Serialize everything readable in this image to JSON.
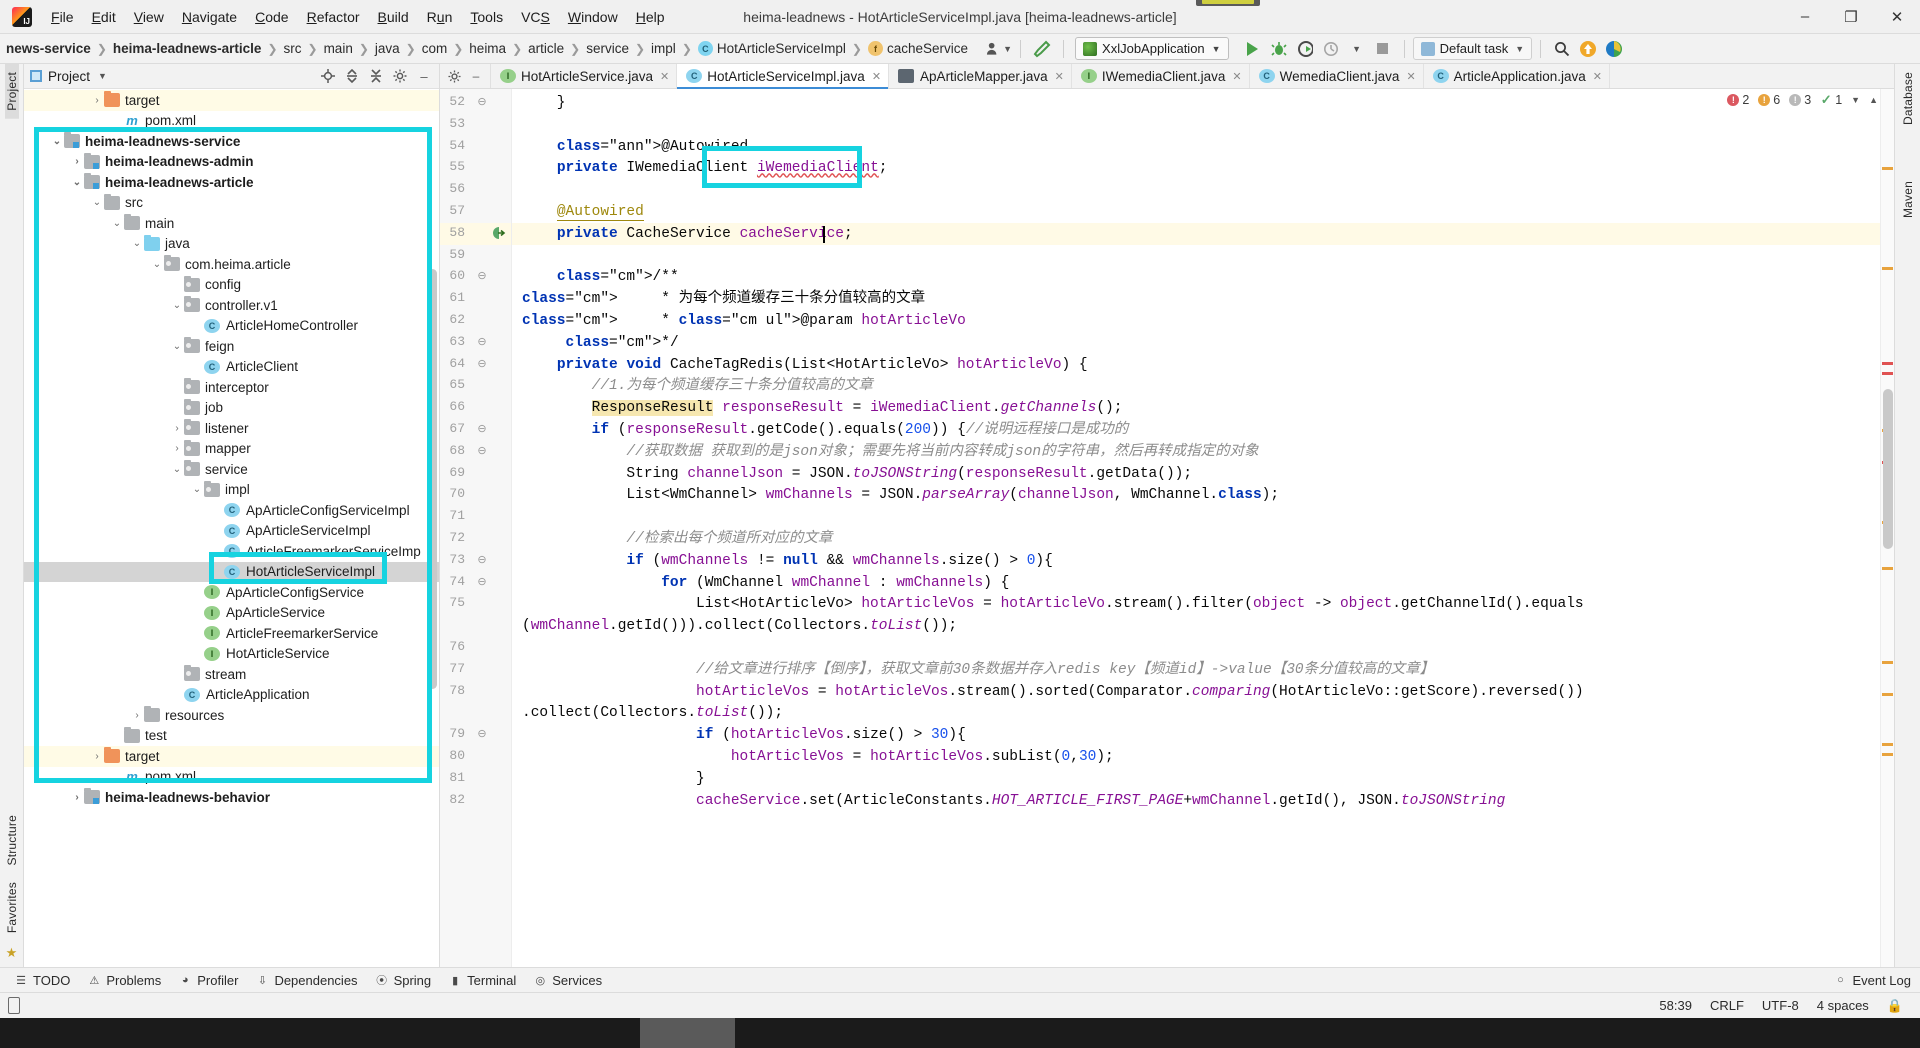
{
  "window": {
    "title": "heima-leadnews - HotArticleServiceImpl.java [heima-leadnews-article]",
    "minimize": "–",
    "maximize": "❐",
    "close": "✕"
  },
  "menu": [
    "File",
    "Edit",
    "View",
    "Navigate",
    "Code",
    "Refactor",
    "Build",
    "Run",
    "Tools",
    "VCS",
    "Window",
    "Help"
  ],
  "navbar": {
    "breadcrumbs": [
      {
        "label": "news-service",
        "bold": true,
        "icon": ""
      },
      {
        "label": "heima-leadnews-article",
        "bold": true,
        "icon": ""
      },
      {
        "label": "src",
        "bold": false,
        "icon": ""
      },
      {
        "label": "main",
        "bold": false,
        "icon": ""
      },
      {
        "label": "java",
        "bold": false,
        "icon": ""
      },
      {
        "label": "com",
        "bold": false,
        "icon": ""
      },
      {
        "label": "heima",
        "bold": false,
        "icon": ""
      },
      {
        "label": "article",
        "bold": false,
        "icon": ""
      },
      {
        "label": "service",
        "bold": false,
        "icon": ""
      },
      {
        "label": "impl",
        "bold": false,
        "icon": ""
      },
      {
        "label": "HotArticleServiceImpl",
        "bold": false,
        "icon": "class-icon"
      },
      {
        "label": "cacheService",
        "bold": false,
        "icon": "field-icon"
      }
    ],
    "run_config": "XxlJobApplication",
    "task_selector": "Default task",
    "icons": {
      "user": "user-icon",
      "build": "hammer-icon",
      "run": "run-icon",
      "debug": "debug-icon",
      "coverage": "run-with-coverage-icon",
      "profile": "profiler-icon",
      "stop": "stop-icon",
      "search": "search-icon",
      "update": "update-project-icon",
      "ide": "ide-assistant-icon"
    }
  },
  "left_strip": [
    "Project",
    "Structure",
    "Favorites"
  ],
  "right_strip": [
    "Database",
    "Maven"
  ],
  "project_panel": {
    "title": "Project",
    "actions": [
      "locate-icon",
      "expand-all-icon",
      "collapse-all-icon",
      "settings-icon",
      "hide-icon"
    ],
    "tree": [
      {
        "indent": 3,
        "arrow": ">",
        "icon": "folder-orange",
        "label": "target",
        "bold": false,
        "highlight": "yellow"
      },
      {
        "indent": 4,
        "arrow": "",
        "icon": "maven",
        "label": "pom.xml",
        "bold": false,
        "highlight": ""
      },
      {
        "indent": 1,
        "arrow": "v",
        "icon": "module",
        "label": "heima-leadnews-service",
        "bold": true,
        "highlight": ""
      },
      {
        "indent": 2,
        "arrow": ">",
        "icon": "module",
        "label": "heima-leadnews-admin",
        "bold": true,
        "highlight": ""
      },
      {
        "indent": 2,
        "arrow": "v",
        "icon": "module",
        "label": "heima-leadnews-article",
        "bold": true,
        "highlight": ""
      },
      {
        "indent": 3,
        "arrow": "v",
        "icon": "folder",
        "label": "src",
        "bold": false,
        "highlight": ""
      },
      {
        "indent": 4,
        "arrow": "v",
        "icon": "folder",
        "label": "main",
        "bold": false,
        "highlight": ""
      },
      {
        "indent": 5,
        "arrow": "v",
        "icon": "folder-blue",
        "label": "java",
        "bold": false,
        "highlight": ""
      },
      {
        "indent": 6,
        "arrow": "v",
        "icon": "package",
        "label": "com.heima.article",
        "bold": false,
        "highlight": ""
      },
      {
        "indent": 7,
        "arrow": "",
        "icon": "package",
        "label": "config",
        "bold": false,
        "highlight": ""
      },
      {
        "indent": 7,
        "arrow": "v",
        "icon": "package",
        "label": "controller.v1",
        "bold": false,
        "highlight": ""
      },
      {
        "indent": 8,
        "arrow": "",
        "icon": "class",
        "label": "ArticleHomeController",
        "bold": false,
        "highlight": ""
      },
      {
        "indent": 7,
        "arrow": "v",
        "icon": "package",
        "label": "feign",
        "bold": false,
        "highlight": ""
      },
      {
        "indent": 8,
        "arrow": "",
        "icon": "class",
        "label": "ArticleClient",
        "bold": false,
        "highlight": ""
      },
      {
        "indent": 7,
        "arrow": "",
        "icon": "package",
        "label": "interceptor",
        "bold": false,
        "highlight": ""
      },
      {
        "indent": 7,
        "arrow": "",
        "icon": "package",
        "label": "job",
        "bold": false,
        "highlight": ""
      },
      {
        "indent": 7,
        "arrow": ">",
        "icon": "package",
        "label": "listener",
        "bold": false,
        "highlight": ""
      },
      {
        "indent": 7,
        "arrow": ">",
        "icon": "package",
        "label": "mapper",
        "bold": false,
        "highlight": ""
      },
      {
        "indent": 7,
        "arrow": "v",
        "icon": "package",
        "label": "service",
        "bold": false,
        "highlight": ""
      },
      {
        "indent": 8,
        "arrow": "v",
        "icon": "package",
        "label": "impl",
        "bold": false,
        "highlight": ""
      },
      {
        "indent": 9,
        "arrow": "",
        "icon": "class",
        "label": "ApArticleConfigServiceImpl",
        "bold": false,
        "highlight": ""
      },
      {
        "indent": 9,
        "arrow": "",
        "icon": "class",
        "label": "ApArticleServiceImpl",
        "bold": false,
        "highlight": ""
      },
      {
        "indent": 9,
        "arrow": "",
        "icon": "class",
        "label": "ArticleFreemarkerServiceImp",
        "bold": false,
        "highlight": ""
      },
      {
        "indent": 9,
        "arrow": "",
        "icon": "class",
        "label": "HotArticleServiceImpl",
        "bold": false,
        "highlight": "selected"
      },
      {
        "indent": 8,
        "arrow": "",
        "icon": "interface",
        "label": "ApArticleConfigService",
        "bold": false,
        "highlight": ""
      },
      {
        "indent": 8,
        "arrow": "",
        "icon": "interface",
        "label": "ApArticleService",
        "bold": false,
        "highlight": ""
      },
      {
        "indent": 8,
        "arrow": "",
        "icon": "interface",
        "label": "ArticleFreemarkerService",
        "bold": false,
        "highlight": ""
      },
      {
        "indent": 8,
        "arrow": "",
        "icon": "interface",
        "label": "HotArticleService",
        "bold": false,
        "highlight": ""
      },
      {
        "indent": 7,
        "arrow": "",
        "icon": "package",
        "label": "stream",
        "bold": false,
        "highlight": ""
      },
      {
        "indent": 7,
        "arrow": "",
        "icon": "springboot",
        "label": "ArticleApplication",
        "bold": false,
        "highlight": ""
      },
      {
        "indent": 5,
        "arrow": ">",
        "icon": "folder",
        "label": "resources",
        "bold": false,
        "highlight": ""
      },
      {
        "indent": 4,
        "arrow": "",
        "icon": "folder",
        "label": "test",
        "bold": false,
        "highlight": ""
      },
      {
        "indent": 3,
        "arrow": ">",
        "icon": "folder-orange",
        "label": "target",
        "bold": false,
        "highlight": "yellow"
      },
      {
        "indent": 4,
        "arrow": "",
        "icon": "maven",
        "label": "pom.xml",
        "bold": false,
        "highlight": ""
      },
      {
        "indent": 2,
        "arrow": ">",
        "icon": "module",
        "label": "heima-leadnews-behavior",
        "bold": true,
        "highlight": ""
      }
    ]
  },
  "editor": {
    "tabs": [
      {
        "label": "HotArticleService.java",
        "icon": "interface-icon",
        "active": false
      },
      {
        "label": "HotArticleServiceImpl.java",
        "icon": "class-icon",
        "active": true
      },
      {
        "label": "ApArticleMapper.java",
        "icon": "mapper-icon",
        "active": false
      },
      {
        "label": "IWemediaClient.java",
        "icon": "interface-icon",
        "active": false
      },
      {
        "label": "WemediaClient.java",
        "icon": "class-icon",
        "active": false
      },
      {
        "label": "ArticleApplication.java",
        "icon": "springboot-icon",
        "active": false
      }
    ],
    "inspection": {
      "errors": "2",
      "warnings": "6",
      "weak": "3",
      "ok": "1"
    },
    "first_line_number": 52,
    "lines": [
      {
        "n": 52,
        "fold": "⊖",
        "text": "    }"
      },
      {
        "n": 53,
        "fold": "",
        "text": ""
      },
      {
        "n": 54,
        "fold": "",
        "text": "    @Autowired"
      },
      {
        "n": 55,
        "fold": "",
        "text": "    private IWemediaClient iWemediaClient;"
      },
      {
        "n": 56,
        "fold": "",
        "text": ""
      },
      {
        "n": 57,
        "fold": "",
        "text": "    @Autowired"
      },
      {
        "n": 58,
        "fold": "",
        "text": "    private CacheService cacheService;"
      },
      {
        "n": 59,
        "fold": "",
        "text": ""
      },
      {
        "n": 60,
        "fold": "⊖",
        "text": "    /**"
      },
      {
        "n": 61,
        "fold": "",
        "text": "     * 为每个频道缓存三十条分值较高的文章"
      },
      {
        "n": 62,
        "fold": "",
        "text": "     * @param hotArticleVo"
      },
      {
        "n": 63,
        "fold": "⊖",
        "text": "     */"
      },
      {
        "n": 64,
        "fold": "⊖",
        "text": "    private void CacheTagRedis(List<HotArticleVo> hotArticleVo) {"
      },
      {
        "n": 65,
        "fold": "",
        "text": "        //1.为每个频道缓存三十条分值较高的文章"
      },
      {
        "n": 66,
        "fold": "",
        "text": "        ResponseResult responseResult = iWemediaClient.getChannels();"
      },
      {
        "n": 67,
        "fold": "⊖",
        "text": "        if (responseResult.getCode().equals(200)) {//说明远程接口是成功的"
      },
      {
        "n": 68,
        "fold": "⊖",
        "text": "            //获取数据 获取到的是json对象；需要先将当前内容转成json的字符串，然后再转成指定的对象"
      },
      {
        "n": 69,
        "fold": "",
        "text": "            String channelJson = JSON.toJSONString(responseResult.getData());"
      },
      {
        "n": 70,
        "fold": "",
        "text": "            List<WmChannel> wmChannels = JSON.parseArray(channelJson, WmChannel.class);"
      },
      {
        "n": 71,
        "fold": "",
        "text": ""
      },
      {
        "n": 72,
        "fold": "",
        "text": "            //检索出每个频道所对应的文章"
      },
      {
        "n": 73,
        "fold": "⊖",
        "text": "            if (wmChannels != null && wmChannels.size() > 0){"
      },
      {
        "n": 74,
        "fold": "⊖",
        "text": "                for (WmChannel wmChannel : wmChannels) {"
      },
      {
        "n": 75,
        "fold": "",
        "text": "                    List<HotArticleVo> hotArticleVos = hotArticleVo.stream().filter(object -> object.getChannelId().equals"
      },
      {
        "n": "",
        "fold": "",
        "text": "(wmChannel.getId())).collect(Collectors.toList());"
      },
      {
        "n": 76,
        "fold": "",
        "text": ""
      },
      {
        "n": 77,
        "fold": "",
        "text": "                    //给文章进行排序【倒序】，获取文章前30条数据并存入redis key【频道id】->value【30条分值较高的文章】"
      },
      {
        "n": 78,
        "fold": "",
        "text": "                    hotArticleVos = hotArticleVos.stream().sorted(Comparator.comparing(HotArticleVo::getScore).reversed())"
      },
      {
        "n": "",
        "fold": "",
        "text": ".collect(Collectors.toList());"
      },
      {
        "n": 79,
        "fold": "⊖",
        "text": "                    if (hotArticleVos.size() > 30){"
      },
      {
        "n": 80,
        "fold": "",
        "text": "                        hotArticleVos = hotArticleVos.subList(0,30);"
      },
      {
        "n": 81,
        "fold": "",
        "text": "                    }"
      },
      {
        "n": 82,
        "fold": "",
        "text": "                    cacheService.set(ArticleConstants.HOT_ARTICLE_FIRST_PAGE+wmChannel.getId(), JSON.toJSONString"
      }
    ]
  },
  "bottom_tools": [
    {
      "label": "TODO",
      "icon": "todo-icon"
    },
    {
      "label": "Problems",
      "icon": "problems-icon"
    },
    {
      "label": "Profiler",
      "icon": "profiler-icon"
    },
    {
      "label": "Dependencies",
      "icon": "dependencies-icon"
    },
    {
      "label": "Spring",
      "icon": "spring-icon"
    },
    {
      "label": "Terminal",
      "icon": "terminal-icon"
    },
    {
      "label": "Services",
      "icon": "services-icon"
    }
  ],
  "bottom_right": {
    "label": "Event Log",
    "icon": "event-log-icon"
  },
  "statusbar": {
    "caret": "58:39",
    "line_sep": "CRLF",
    "encoding": "UTF-8",
    "indent": "4 spaces",
    "lock": "lock-icon"
  },
  "colors": {
    "accent": "#16d3e0",
    "tab_active_underline": "#3c8cd6",
    "selection": "#d4d4d4",
    "caret_row": "#fffae6"
  }
}
